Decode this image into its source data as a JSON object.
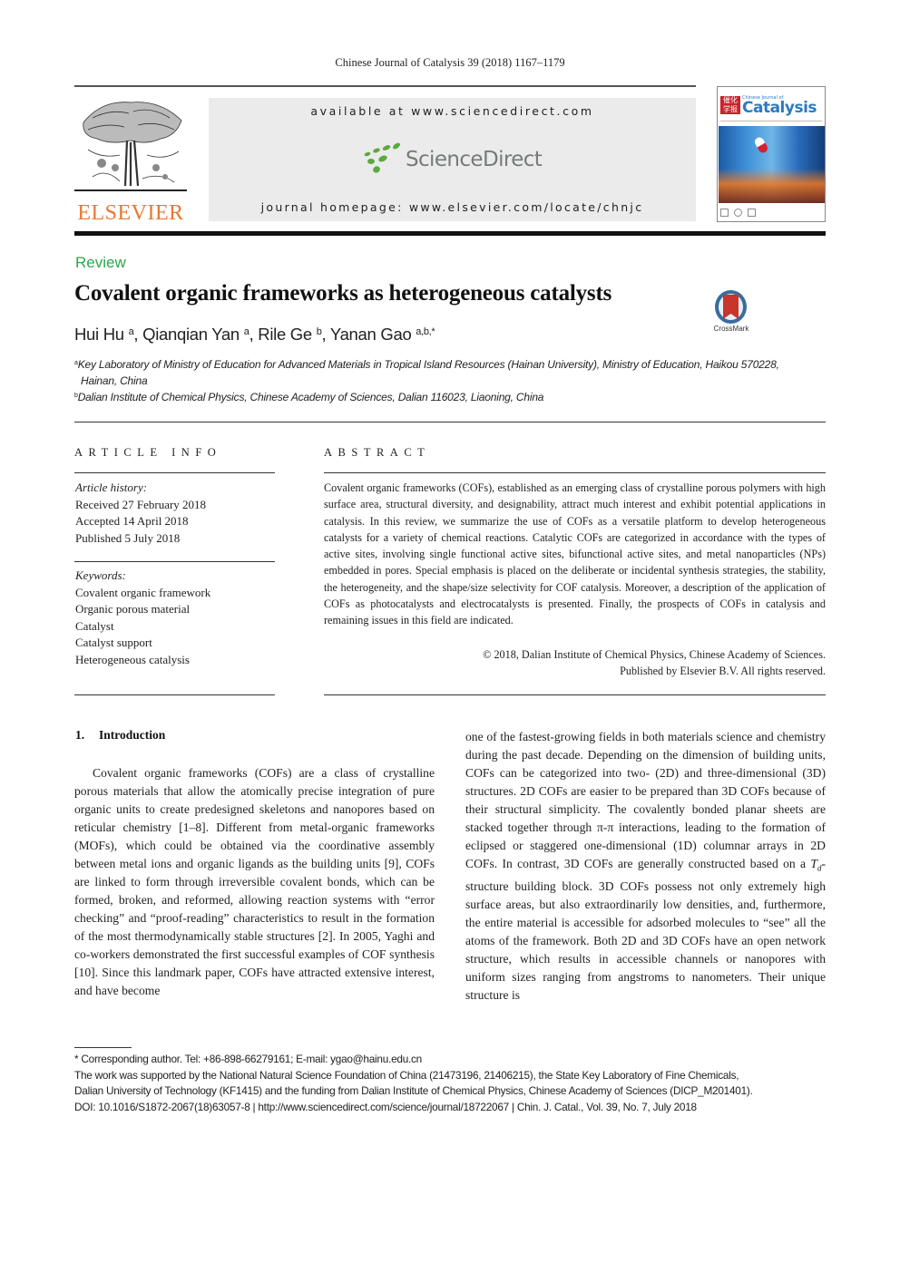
{
  "header": {
    "journal_citation": "Chinese Journal of Catalysis 39 (2018) 1167–1179",
    "publisher_logo_text": "ELSEVIER",
    "available_at": "available at www.sciencedirect.com",
    "sciencedirect_brand": "ScienceDirect",
    "journal_homepage": "journal homepage: www.elsevier.com/locate/chnjc",
    "cover": {
      "seal_text": "催化学报",
      "small_title": "Chinese Journal of",
      "title": "Catalysis"
    }
  },
  "article": {
    "type_label": "Review",
    "title": "Covalent organic frameworks as heterogeneous catalysts",
    "crossmark_label": "CrossMark",
    "authors": [
      {
        "name": "Hui Hu",
        "sup": "a"
      },
      {
        "name": "Qianqian Yan",
        "sup": "a"
      },
      {
        "name": "Rile Ge",
        "sup": "b"
      },
      {
        "name": "Yanan Gao",
        "sup": "a,b,*"
      }
    ],
    "affiliations": {
      "a_mark": "a",
      "a_line1": "Key Laboratory of Ministry of Education for Advanced Materials in Tropical Island Resources (Hainan University), Ministry of Education, Haikou 570228,",
      "a_line2": "Hainan, China",
      "b_mark": "b",
      "b_line1": "Dalian Institute of Chemical Physics, Chinese Academy of Sciences, Dalian 116023, Liaoning, China"
    }
  },
  "article_info": {
    "heading": "ARTICLE INFO",
    "history_label": "Article history:",
    "received": "Received 27 February 2018",
    "accepted": "Accepted 14 April 2018",
    "published": "Published 5 July 2018",
    "keywords_label": "Keywords:",
    "keywords": [
      "Covalent organic framework",
      "Organic porous material",
      "Catalyst",
      "Catalyst support",
      "Heterogeneous catalysis"
    ]
  },
  "abstract": {
    "heading": "ABSTRACT",
    "text": "Covalent organic frameworks (COFs), established as an emerging class of crystalline porous polymers with high surface area, structural diversity, and designability, attract much interest and exhibit potential applications in catalysis. In this review, we summarize the use of COFs as a versatile platform to develop heterogeneous catalysts for a variety of chemical reactions. Catalytic COFs are categorized in accordance with the types of active sites, involving single functional active sites, bifunctional active sites, and metal nanoparticles (NPs) embedded in pores. Special emphasis is placed on the deliberate or incidental synthesis strategies, the stability, the heterogeneity, and the shape/size selectivity for COF catalysis. Moreover, a description of the application of COFs as photocatalysts and electrocatalysts is presented. Finally, the prospects of COFs in catalysis and remaining issues in this field are indicated.",
    "copyright_line1": "© 2018, Dalian Institute of Chemical Physics, Chinese Academy of Sciences.",
    "copyright_line2": "Published by Elsevier B.V. All rights reserved."
  },
  "introduction": {
    "number": "1.",
    "heading": "Introduction",
    "left_column": "Covalent organic frameworks (COFs) are a class of crystalline porous materials that allow the atomically precise integration of pure organic units to create predesigned skeletons and nanopores based on reticular chemistry [1–8]. Different from metal-organic frameworks (MOFs), which could be obtained via the coordinative assembly between metal ions and organic ligands as the building units [9], COFs are linked to form through irreversible covalent bonds, which can be formed, broken, and reformed, allowing reaction systems with “error checking” and “proof-reading” characteristics to result in the formation of the most thermodynamically stable structures [2]. In 2005, Yaghi and co-workers demonstrated the first successful examples of COF synthesis [10]. Since this landmark paper, COFs have attracted extensive interest, and have become",
    "right_column_part1": "one of the fastest-growing fields in both materials science and chemistry during the past decade. Depending on the dimension of building units, COFs can be categorized into two- (2D) and three-dimensional (3D) structures. 2D COFs are easier to be prepared than 3D COFs because of their structural simplicity. The covalently bonded planar sheets are stacked together through π-π interactions, leading to the formation of eclipsed or staggered one-dimensional (1D) columnar arrays in 2D COFs. In contrast, 3D COFs are generally constructed based on a ",
    "right_column_td_main": "T",
    "right_column_td_sub": "d",
    "right_column_part2": "-structure building block. 3D COFs possess not only extremely high surface areas, but also extraordinarily low densities, and, furthermore, the entire material is accessible for adsorbed molecules to “see” all the atoms of the framework. Both 2D and 3D COFs have an open network structure, which results in accessible channels or nanopores with uniform sizes ranging from angstroms to nanometers. Their unique structure is"
  },
  "footnotes": {
    "corresponding": "* Corresponding author. Tel: +86-898-66279161; E-mail: ygao@hainu.edu.cn",
    "funding_line1": "The work was supported by the National Natural Science Foundation of China (21473196, 21406215), the State Key Laboratory of Fine Chemicals,",
    "funding_line2": "Dalian University of Technology (KF1415) and the funding from Dalian Institute of Chemical Physics, Chinese Academy of Sciences (DICP_M201401).",
    "doi_line": "DOI: 10.1016/S1872-2067(18)63057-8 | http://www.sciencedirect.com/science/journal/18722067 | Chin. J. Catal., Vol. 39, No. 7, July 2018"
  },
  "colors": {
    "review_label": "#2aa84a",
    "elsevier_orange": "#e8772e",
    "sciencedirect_green": "#5aaa3c",
    "sciencedirect_gray": "#777a7c",
    "catalysis_blue": "#2b7bc0"
  }
}
